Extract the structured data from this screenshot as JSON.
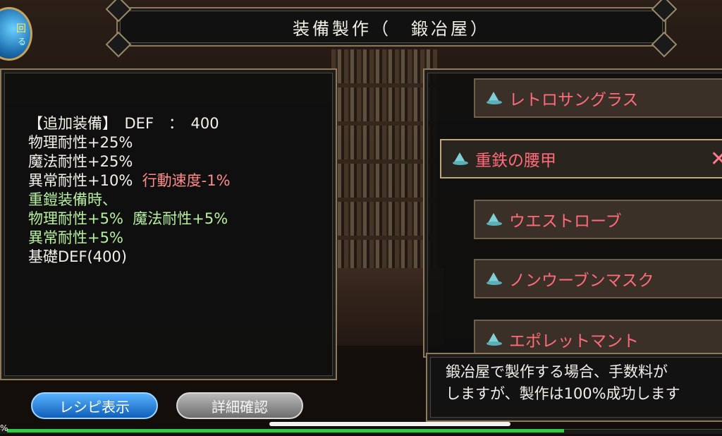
{
  "title": "装備製作（　鍛冶屋）",
  "badge": {
    "line1": "回",
    "line2": "る"
  },
  "stats": [
    {
      "label": "【追加装備】　DEF　：　400",
      "extra": ""
    },
    {
      "label": "物理耐性+25%",
      "extra": ""
    },
    {
      "label": "魔法耐性+25%",
      "extra": ""
    },
    {
      "label": "異常耐性+10%",
      "extra": "行動速度-1%"
    }
  ],
  "bonus": [
    {
      "label": "重鎧装備時、",
      "extra": ""
    },
    {
      "label": "物理耐性+5%",
      "extra": "魔法耐性+5%"
    },
    {
      "label": "異常耐性+5%",
      "extra": ""
    }
  ],
  "base_def": "基礎DEF(400)",
  "items": [
    {
      "name": "レトロサングラス",
      "selected": false
    },
    {
      "name": "重鉄の腰甲",
      "selected": true
    },
    {
      "name": "ウエストローブ",
      "selected": false
    },
    {
      "name": "ノンウーブンマスク",
      "selected": false
    },
    {
      "name": "エポレットマント",
      "selected": false
    }
  ],
  "close_symbol": "✕",
  "message": {
    "line1": "鍛冶屋で製作する場合、手数料が",
    "line2": "しますが、製作は100%成功します"
  },
  "buttons": {
    "recipe": "レシピ表示",
    "detail": "詳細確認"
  },
  "progress_text": "%",
  "colors": {
    "item_text": "#ff6b78",
    "bonus": "#b7efa0",
    "penalty": "#ff8a8a",
    "button_blue": "#0f5fb8"
  },
  "icons": {
    "item": "wizard-hat-icon",
    "close": "close-icon"
  }
}
